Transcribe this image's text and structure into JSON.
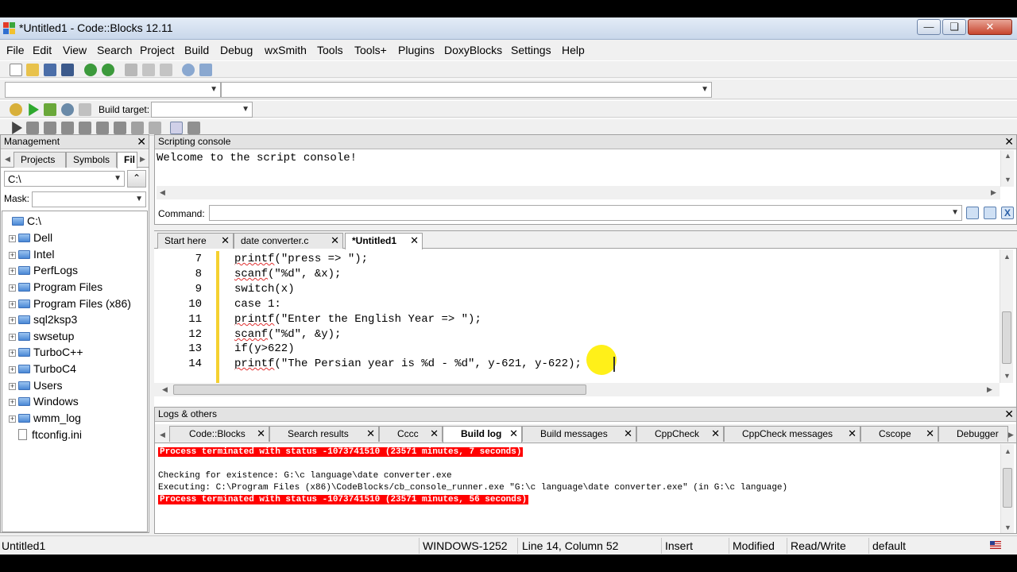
{
  "window": {
    "title": "*Untitled1 - Code::Blocks 12.11"
  },
  "menu": [
    "File",
    "Edit",
    "View",
    "Search",
    "Project",
    "Build",
    "Debug",
    "wxSmith",
    "Tools",
    "Tools+",
    "Plugins",
    "DoxyBlocks",
    "Settings",
    "Help"
  ],
  "build_toolbar": {
    "target_label": "Build target:",
    "target_value": ""
  },
  "management": {
    "title": "Management",
    "tabs": [
      "Projects",
      "Symbols",
      "Fil"
    ],
    "path": "C:\\",
    "mask_label": "Mask:",
    "mask_value": "",
    "root": "C:\\",
    "folders": [
      "Dell",
      "Intel",
      "PerfLogs",
      "Program Files",
      "Program Files (x86)",
      "sql2ksp3",
      "swsetup",
      "TurboC++",
      "TurboC4",
      "Users",
      "Windows",
      "wmm_log"
    ],
    "files": [
      "ftconfig.ini"
    ]
  },
  "scripting": {
    "title": "Scripting console",
    "welcome": "Welcome to the script console!",
    "command_label": "Command:",
    "command_value": ""
  },
  "editor": {
    "tabs": [
      {
        "label": "Start here",
        "active": false
      },
      {
        "label": "date converter.c",
        "active": false
      },
      {
        "label": "*Untitled1",
        "active": true
      }
    ],
    "lines": [
      {
        "n": "7",
        "pre": "",
        "fn": "printf",
        "rest": "(\"press => \");"
      },
      {
        "n": "8",
        "pre": "",
        "fn": "scanf",
        "rest": "(\"%d\", &x);"
      },
      {
        "n": "9",
        "pre": "switch(x)",
        "fn": "",
        "rest": ""
      },
      {
        "n": "10",
        "pre": "case 1:",
        "fn": "",
        "rest": ""
      },
      {
        "n": "11",
        "pre": "",
        "fn": "printf",
        "rest": "(\"Enter the English Year => \");"
      },
      {
        "n": "12",
        "pre": "",
        "fn": "scanf",
        "rest": "(\"%d\", &y);"
      },
      {
        "n": "13",
        "pre": "if(y>622)",
        "fn": "",
        "rest": ""
      },
      {
        "n": "14",
        "pre": "",
        "fn": "printf",
        "rest": "(\"The Persian year is %d - %d\", y-621, y-622);"
      }
    ]
  },
  "logs": {
    "title": "Logs & others",
    "tabs": [
      {
        "label": "Code::Blocks",
        "active": false
      },
      {
        "label": "Search results",
        "active": false
      },
      {
        "label": "Cccc",
        "active": false
      },
      {
        "label": "Build log",
        "active": true
      },
      {
        "label": "Build messages",
        "active": false
      },
      {
        "label": "CppCheck",
        "active": false
      },
      {
        "label": "CppCheck messages",
        "active": false
      },
      {
        "label": "Cscope",
        "active": false
      },
      {
        "label": "Debugger",
        "active": false
      }
    ],
    "entries": [
      {
        "text": "Process terminated with status -1073741510 (23571 minutes, 7 seconds)",
        "error": true
      },
      {
        "text": "",
        "error": false
      },
      {
        "text": "Checking for existence: G:\\c language\\date converter.exe",
        "error": false
      },
      {
        "text": "Executing: C:\\Program Files (x86)\\CodeBlocks/cb_console_runner.exe \"G:\\c language\\date converter.exe\" (in G:\\c language)",
        "error": false
      },
      {
        "text": "Process terminated with status -1073741510 (23571 minutes, 56 seconds)",
        "error": true
      }
    ]
  },
  "status": {
    "file": "Untitled1",
    "encoding": "WINDOWS-1252",
    "position": "Line 14, Column 52",
    "mode": "Insert",
    "modified": "Modified",
    "access": "Read/Write",
    "lang": "default"
  },
  "colors": {
    "error_bg": "#ff0000",
    "cursor_highlight": "#ffee00",
    "caret_bar": "#f5d130"
  }
}
